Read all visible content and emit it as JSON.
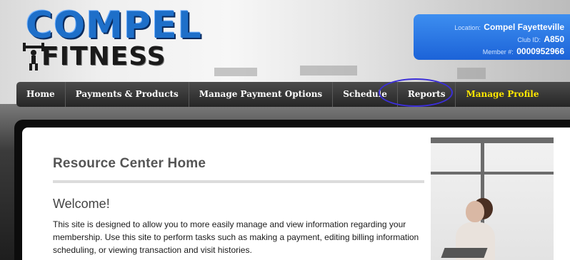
{
  "logo": {
    "line1": "COMPEL",
    "line2": "FITNESS"
  },
  "member": {
    "location_label": "Location:",
    "location_value": "Compel Fayetteville",
    "club_label": "Club ID:",
    "club_value": "A850",
    "member_label": "Member #:",
    "member_value": "0000952966"
  },
  "nav": {
    "items": [
      {
        "label": "Home"
      },
      {
        "label": "Payments & Products"
      },
      {
        "label": "Manage Payment Options"
      },
      {
        "label": "Schedule"
      },
      {
        "label": "Reports"
      },
      {
        "label": "Manage Profile"
      }
    ],
    "highlight_color": "#ffe600"
  },
  "main": {
    "title": "Resource Center Home",
    "welcome_heading": "Welcome!",
    "paragraph": "This site is designed to allow you to more easily manage and view information regarding your membership. Use this site to perform tasks such as making a payment, editing billing information scheduling, or viewing transaction and visit histories."
  },
  "colors": {
    "accent_blue": "#1c63d8",
    "nav_bg": "#262626",
    "annotation_circle": "#3b2ed8"
  }
}
